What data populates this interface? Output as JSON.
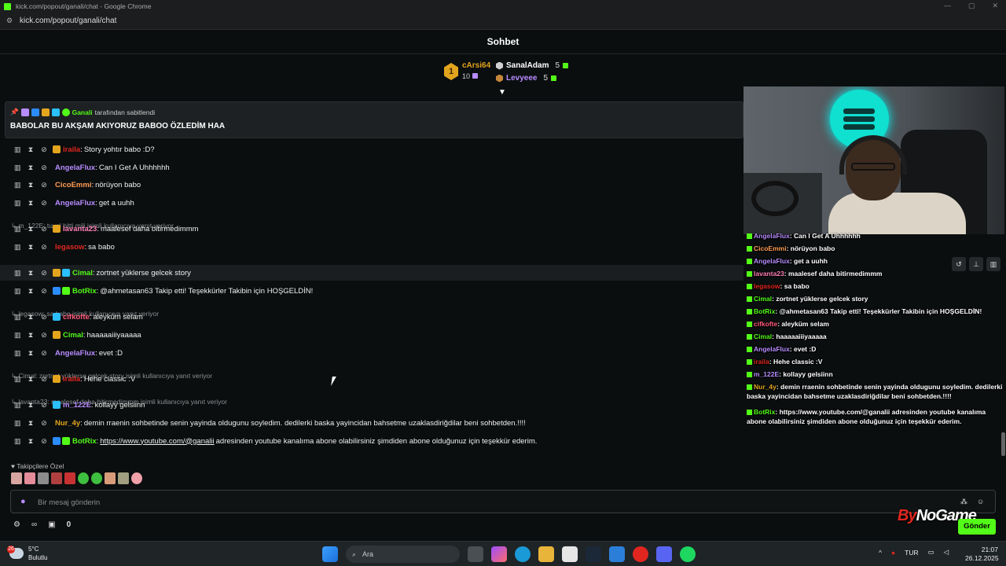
{
  "window": {
    "title": "kick.com/popout/ganali/chat - Google Chrome",
    "url": "kick.com/popout/ganali/chat"
  },
  "chat": {
    "header": "Sohbet",
    "leaderboard": {
      "first": {
        "rank": "1",
        "name": "cArsi64",
        "count": "10"
      },
      "others": [
        {
          "name": "SanalAdam",
          "count": "5",
          "color": "#ffffff"
        },
        {
          "name": "Levyeee",
          "count": "5",
          "color": "#b78cff"
        }
      ]
    },
    "pinned": {
      "by_user": "Ganali",
      "by_suffix": "tarafından sabitlendi",
      "message": "BABOLAR BU AKŞAM AKIYORUZ BABOO ÖZLEDİM HAA"
    },
    "messages": [
      {
        "reply": "",
        "user": "iraila",
        "color": "#e0261f",
        "text": "Story yohtır babo :D?"
      },
      {
        "reply": "",
        "user": "AngelaFlux",
        "color": "#b78cff",
        "text": "Can I Get A Uhhhhhh"
      },
      {
        "reply": "",
        "user": "CicoEmmi",
        "color": "#ff9c54",
        "text": "nörüyon babo"
      },
      {
        "reply": "",
        "user": "AngelaFlux",
        "color": "#b78cff",
        "text": "get a uuhh"
      },
      {
        "reply": "m_122E: tuval bitti mili isimli kullanıcıya yanıt veriyor",
        "user": "lavanta23",
        "color": "#ff7eb6",
        "text": "maalesef daha bitirmedimmm"
      },
      {
        "reply": "",
        "user": "legasow",
        "color": "#e0261f",
        "text": "sa babo"
      },
      {
        "reply": "iraila: Story yohtır babo :D? isimli kullanıcıya yanıt veriyor",
        "user": "Cimal",
        "color": "#53fc18",
        "text": "zortnet yüklerse gelcek story"
      },
      {
        "reply": "",
        "user": "BotRix",
        "color": "#53fc18",
        "text": "@ahmetasan63 Takip etti! Teşekkürler Takibin için HOŞGELDİN!"
      },
      {
        "reply": "legasow: sa babo isimli kullanıcıya yanıt veriyor",
        "user": "cifkofte",
        "color": "#ff5a7a",
        "text": "aleyküm selam"
      },
      {
        "reply": "",
        "user": "Cimal",
        "color": "#53fc18",
        "text": "haaaaaiiiyaaaaa"
      },
      {
        "reply": "",
        "user": "AngelaFlux",
        "color": "#b78cff",
        "text": "evet :D"
      },
      {
        "reply": "Cimal: zortnet yüklerse gelcek story isimli kullanıcıya yanıt veriyor",
        "user": "iraila",
        "color": "#e0261f",
        "text": "Hehe classic :V"
      },
      {
        "reply": "lavanta23: maalesef daha bitirmedimmm isimli kullanıcıya yanıt veriyor",
        "user": "m_122E",
        "color": "#b78cff",
        "text": "kollayy gelsiinn"
      },
      {
        "reply": "",
        "user": "Nur_4y",
        "color": "#e3a51e",
        "text": "demin rraenin sohbetinde senin yayinda oldugunu soyledim. dedilerki baska yayincidan bahsetme uzaklasdiriğdilar beni sohbetden.!!!!"
      },
      {
        "reply": "",
        "user": "BotRix",
        "color": "#53fc18",
        "text_prefix": "https://www.youtube.com/@ganalii",
        "text": "adresinden youtube kanalıma abone olabilirsiniz şimdiden abone olduğunuz için teşekkür ederim."
      }
    ],
    "followers_label": "Takipçilere Özel",
    "input": {
      "placeholder": "Bir mesaj gönderin",
      "value": ""
    },
    "bottom": {
      "count": "0"
    },
    "send_label": "Gönder"
  },
  "overlay": {
    "watermark_by": "By",
    "watermark_rest": "NoGame",
    "lines": [
      {
        "user": "AngelaFlux",
        "color": "#b78cff",
        "text": ": Can I Get A Uhhhhhh"
      },
      {
        "user": "CicoEmmi",
        "color": "#ff9c54",
        "text": ": nörüyon babo"
      },
      {
        "user": "AngelaFlux",
        "color": "#b78cff",
        "text": ": get a uuhh"
      },
      {
        "user": "lavanta23",
        "color": "#ff7eb6",
        "text": ": maalesef daha bitirmedimmm"
      },
      {
        "user": "legasow",
        "color": "#e0261f",
        "text": ": sa babo"
      },
      {
        "user": "Cimal",
        "color": "#53fc18",
        "text": ": zortnet yüklerse gelcek story"
      },
      {
        "user": "BotRix",
        "color": "#53fc18",
        "text": ": @ahmetasan63 Takip etti! Teşekkürler Takibin için HOŞGELDİN!"
      },
      {
        "user": "cifkofte",
        "color": "#ff5a7a",
        "text": ": aleyküm selam"
      },
      {
        "user": "Cimal",
        "color": "#53fc18",
        "text": ": haaaaaiiiyaaaaa"
      },
      {
        "user": "AngelaFlux",
        "color": "#b78cff",
        "text": ": evet :D"
      },
      {
        "user": "iraila",
        "color": "#e0261f",
        "text": ": Hehe classic :V"
      },
      {
        "user": "m_122E",
        "color": "#b78cff",
        "text": ": kollayy gelsiinn"
      },
      {
        "user": "Nur_4y",
        "color": "#e3a51e",
        "text": ": demin rraenin sohbetinde senin yayinda oldugunu soyledim. dedilerki baska yayincidan bahsetme uzaklasdiriğdilar beni sohbetden.!!!!"
      },
      {
        "user": "BotRix",
        "color": "#53fc18",
        "text": ": https://www.youtube.com/@ganalii adresinden youtube kanalıma abone olabilirsiniz şimdiden abone olduğunuz için teşekkür ederim."
      }
    ]
  },
  "taskbar": {
    "weather_temp": "5°C",
    "weather_desc": "Bulutlu",
    "search_label": "Ara",
    "lang": "TUR",
    "time": "21:07",
    "date": "26.12.2025"
  }
}
